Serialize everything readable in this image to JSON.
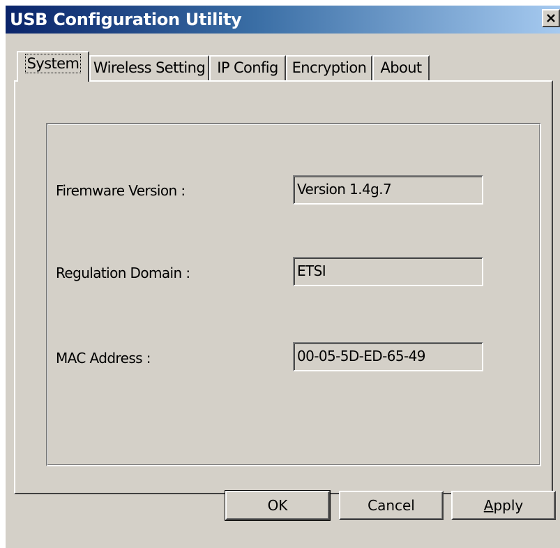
{
  "window": {
    "title": "USB Configuration Utility"
  },
  "tabs": [
    {
      "label": "System",
      "active": true
    },
    {
      "label": "Wireless Setting",
      "active": false
    },
    {
      "label": "IP Config",
      "active": false
    },
    {
      "label": "Encryption",
      "active": false
    },
    {
      "label": "About",
      "active": false
    }
  ],
  "system": {
    "firmware_label": "Firemware Version :",
    "firmware_value": "Version 1.4g.7",
    "regulation_label": "Regulation Domain :",
    "regulation_value": "ETSI",
    "mac_label": "MAC Address :",
    "mac_value": "00-05-5D-ED-65-49"
  },
  "buttons": {
    "ok": "OK",
    "cancel": "Cancel",
    "apply_accel": "A",
    "apply_rest": "pply"
  },
  "colors": {
    "face": "#d4d0c8",
    "title_start": "#0a246a",
    "title_end": "#a6caf0"
  },
  "icons": {
    "close": "close-icon"
  }
}
